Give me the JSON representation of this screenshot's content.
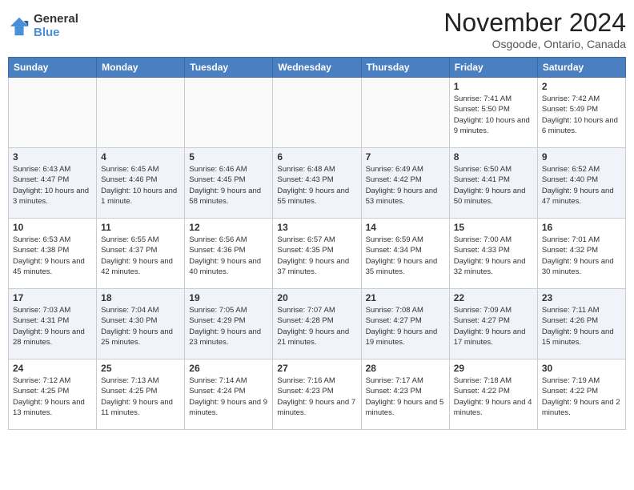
{
  "logo": {
    "general": "General",
    "blue": "Blue"
  },
  "title": "November 2024",
  "location": "Osgoode, Ontario, Canada",
  "weekdays": [
    "Sunday",
    "Monday",
    "Tuesday",
    "Wednesday",
    "Thursday",
    "Friday",
    "Saturday"
  ],
  "weeks": [
    [
      {
        "day": "",
        "info": ""
      },
      {
        "day": "",
        "info": ""
      },
      {
        "day": "",
        "info": ""
      },
      {
        "day": "",
        "info": ""
      },
      {
        "day": "",
        "info": ""
      },
      {
        "day": "1",
        "info": "Sunrise: 7:41 AM\nSunset: 5:50 PM\nDaylight: 10 hours and 9 minutes."
      },
      {
        "day": "2",
        "info": "Sunrise: 7:42 AM\nSunset: 5:49 PM\nDaylight: 10 hours and 6 minutes."
      }
    ],
    [
      {
        "day": "3",
        "info": "Sunrise: 6:43 AM\nSunset: 4:47 PM\nDaylight: 10 hours and 3 minutes."
      },
      {
        "day": "4",
        "info": "Sunrise: 6:45 AM\nSunset: 4:46 PM\nDaylight: 10 hours and 1 minute."
      },
      {
        "day": "5",
        "info": "Sunrise: 6:46 AM\nSunset: 4:45 PM\nDaylight: 9 hours and 58 minutes."
      },
      {
        "day": "6",
        "info": "Sunrise: 6:48 AM\nSunset: 4:43 PM\nDaylight: 9 hours and 55 minutes."
      },
      {
        "day": "7",
        "info": "Sunrise: 6:49 AM\nSunset: 4:42 PM\nDaylight: 9 hours and 53 minutes."
      },
      {
        "day": "8",
        "info": "Sunrise: 6:50 AM\nSunset: 4:41 PM\nDaylight: 9 hours and 50 minutes."
      },
      {
        "day": "9",
        "info": "Sunrise: 6:52 AM\nSunset: 4:40 PM\nDaylight: 9 hours and 47 minutes."
      }
    ],
    [
      {
        "day": "10",
        "info": "Sunrise: 6:53 AM\nSunset: 4:38 PM\nDaylight: 9 hours and 45 minutes."
      },
      {
        "day": "11",
        "info": "Sunrise: 6:55 AM\nSunset: 4:37 PM\nDaylight: 9 hours and 42 minutes."
      },
      {
        "day": "12",
        "info": "Sunrise: 6:56 AM\nSunset: 4:36 PM\nDaylight: 9 hours and 40 minutes."
      },
      {
        "day": "13",
        "info": "Sunrise: 6:57 AM\nSunset: 4:35 PM\nDaylight: 9 hours and 37 minutes."
      },
      {
        "day": "14",
        "info": "Sunrise: 6:59 AM\nSunset: 4:34 PM\nDaylight: 9 hours and 35 minutes."
      },
      {
        "day": "15",
        "info": "Sunrise: 7:00 AM\nSunset: 4:33 PM\nDaylight: 9 hours and 32 minutes."
      },
      {
        "day": "16",
        "info": "Sunrise: 7:01 AM\nSunset: 4:32 PM\nDaylight: 9 hours and 30 minutes."
      }
    ],
    [
      {
        "day": "17",
        "info": "Sunrise: 7:03 AM\nSunset: 4:31 PM\nDaylight: 9 hours and 28 minutes."
      },
      {
        "day": "18",
        "info": "Sunrise: 7:04 AM\nSunset: 4:30 PM\nDaylight: 9 hours and 25 minutes."
      },
      {
        "day": "19",
        "info": "Sunrise: 7:05 AM\nSunset: 4:29 PM\nDaylight: 9 hours and 23 minutes."
      },
      {
        "day": "20",
        "info": "Sunrise: 7:07 AM\nSunset: 4:28 PM\nDaylight: 9 hours and 21 minutes."
      },
      {
        "day": "21",
        "info": "Sunrise: 7:08 AM\nSunset: 4:27 PM\nDaylight: 9 hours and 19 minutes."
      },
      {
        "day": "22",
        "info": "Sunrise: 7:09 AM\nSunset: 4:27 PM\nDaylight: 9 hours and 17 minutes."
      },
      {
        "day": "23",
        "info": "Sunrise: 7:11 AM\nSunset: 4:26 PM\nDaylight: 9 hours and 15 minutes."
      }
    ],
    [
      {
        "day": "24",
        "info": "Sunrise: 7:12 AM\nSunset: 4:25 PM\nDaylight: 9 hours and 13 minutes."
      },
      {
        "day": "25",
        "info": "Sunrise: 7:13 AM\nSunset: 4:25 PM\nDaylight: 9 hours and 11 minutes."
      },
      {
        "day": "26",
        "info": "Sunrise: 7:14 AM\nSunset: 4:24 PM\nDaylight: 9 hours and 9 minutes."
      },
      {
        "day": "27",
        "info": "Sunrise: 7:16 AM\nSunset: 4:23 PM\nDaylight: 9 hours and 7 minutes."
      },
      {
        "day": "28",
        "info": "Sunrise: 7:17 AM\nSunset: 4:23 PM\nDaylight: 9 hours and 5 minutes."
      },
      {
        "day": "29",
        "info": "Sunrise: 7:18 AM\nSunset: 4:22 PM\nDaylight: 9 hours and 4 minutes."
      },
      {
        "day": "30",
        "info": "Sunrise: 7:19 AM\nSunset: 4:22 PM\nDaylight: 9 hours and 2 minutes."
      }
    ]
  ]
}
